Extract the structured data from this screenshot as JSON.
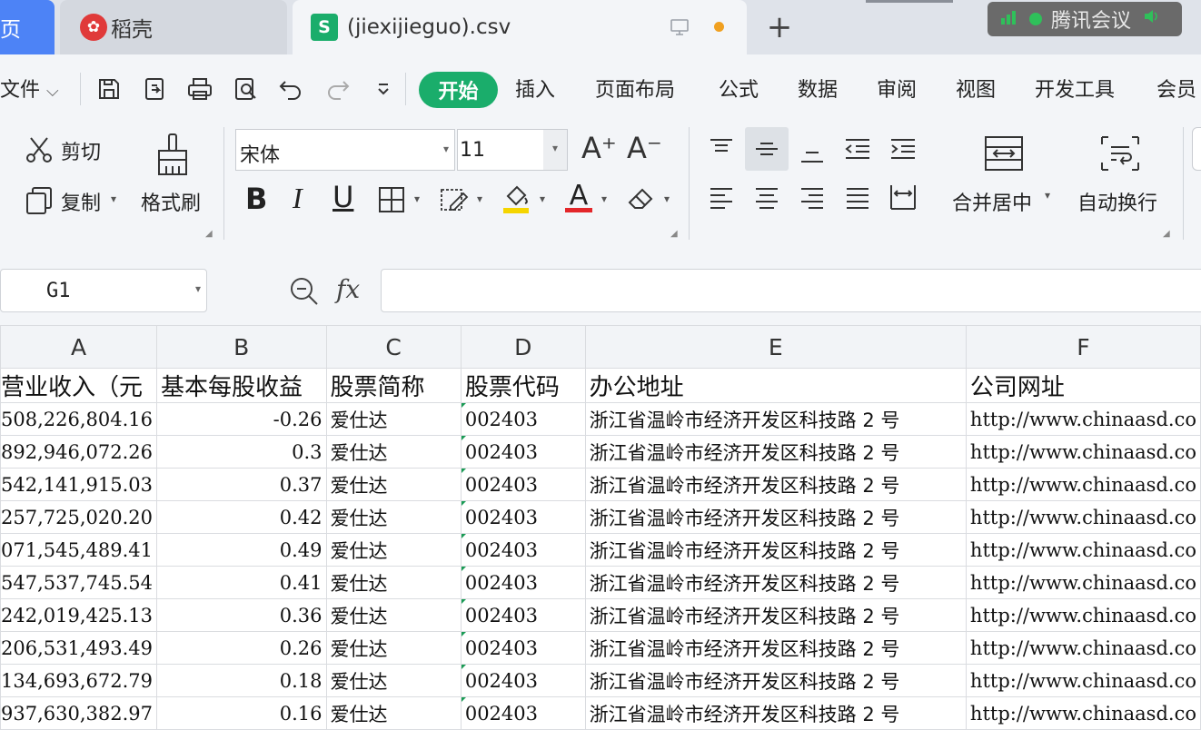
{
  "tabs": {
    "home_label": "页",
    "daoke_label": "稻壳",
    "csv_label": "(jiexijieguo).csv",
    "new_tab": "+"
  },
  "meeting": {
    "label": "腾讯会议"
  },
  "menu": {
    "file": "文件",
    "items": [
      "开始",
      "插入",
      "页面布局",
      "公式",
      "数据",
      "审阅",
      "视图",
      "开发工具",
      "会员"
    ]
  },
  "ribbon": {
    "cut": "剪切",
    "copy": "复制",
    "format_painter": "格式刷",
    "font_name": "宋体",
    "font_size": "11",
    "merge_center": "合并居中",
    "wrap_text": "自动换行",
    "bold": "B",
    "italic": "I",
    "underline": "U",
    "grow_font": "A⁺",
    "shrink_font": "A⁻",
    "font_color_letter": "A"
  },
  "formula_bar": {
    "cell_ref": "G1",
    "fx": "fx",
    "value": ""
  },
  "colors": {
    "accent_green": "#1aad6b",
    "tab_blue": "#4d83f6",
    "fill_yellow": "#f5d500",
    "font_red": "#e3262a"
  },
  "sheet": {
    "columns": [
      "A",
      "B",
      "C",
      "D",
      "E",
      "F"
    ],
    "headers": [
      "营业收入（元",
      "基本每股收益",
      "股票简称",
      "股票代码",
      "办公地址",
      "公司网址"
    ],
    "rows": [
      [
        "508,226,804.16",
        "-0.26",
        "爱仕达",
        "002403",
        "浙江省温岭市经济开发区科技路 2 号",
        "http://www.chinaasd.co"
      ],
      [
        "892,946,072.26",
        "0.3",
        "爱仕达",
        "002403",
        "浙江省温岭市经济开发区科技路 2 号",
        "http://www.chinaasd.co"
      ],
      [
        "542,141,915.03",
        "0.37",
        "爱仕达",
        "002403",
        "浙江省温岭市经济开发区科技路 2 号",
        "http://www.chinaasd.co"
      ],
      [
        "257,725,020.20",
        "0.42",
        "爱仕达",
        "002403",
        "浙江省温岭市经济开发区科技路 2 号",
        "http://www.chinaasd.co"
      ],
      [
        "071,545,489.41",
        "0.49",
        "爱仕达",
        "002403",
        "浙江省温岭市经济开发区科技路 2 号",
        "http://www.chinaasd.co"
      ],
      [
        "547,537,745.54",
        "0.41",
        "爱仕达",
        "002403",
        "浙江省温岭市经济开发区科技路 2 号",
        "http://www.chinaasd.co"
      ],
      [
        "242,019,425.13",
        "0.36",
        "爱仕达",
        "002403",
        "浙江省温岭市经济开发区科技路 2 号",
        "http://www.chinaasd.co"
      ],
      [
        "206,531,493.49",
        "0.26",
        "爱仕达",
        "002403",
        "浙江省温岭市经济开发区科技路 2 号",
        "http://www.chinaasd.co"
      ],
      [
        "134,693,672.79",
        "0.18",
        "爱仕达",
        "002403",
        "浙江省温岭市经济开发区科技路 2 号",
        "http://www.chinaasd.co"
      ],
      [
        "937,630,382.97",
        "0.16",
        "爱仕达",
        "002403",
        "浙江省温岭市经济开发区科技路 2 号",
        "http://www.chinaasd.co"
      ]
    ]
  }
}
